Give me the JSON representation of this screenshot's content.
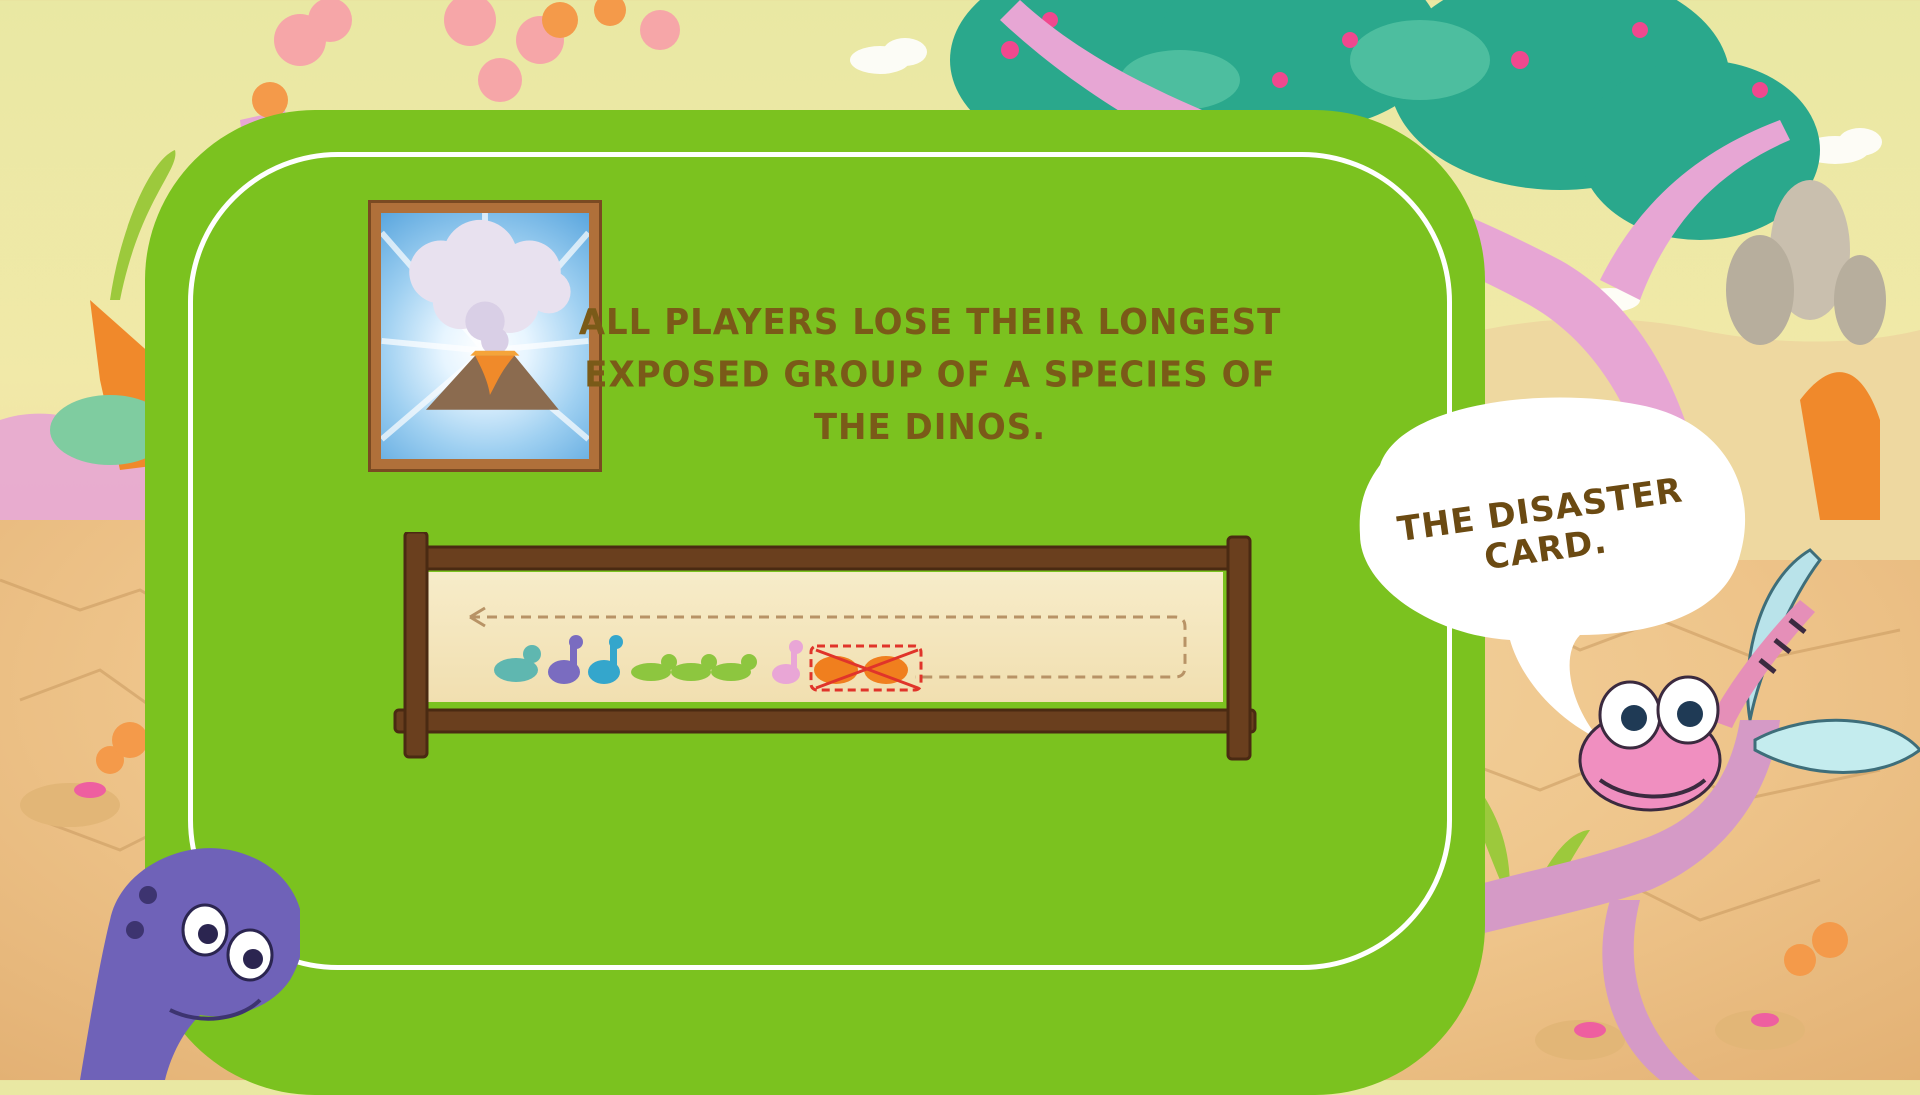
{
  "rule_text": "ALL PLAYERS LOSE THEIR LONGEST EXPOSED GROUP OF A SPECIES OF THE DINOS.",
  "bubble_text": "THE DISASTER CARD.",
  "card": {
    "name": "volcano-disaster-card"
  },
  "dino_row": {
    "sequence": [
      "teal",
      "purple",
      "blue",
      "green",
      "green",
      "green",
      "pink",
      "orange",
      "orange"
    ],
    "crossed_out": [
      "orange",
      "orange"
    ]
  },
  "colors": {
    "panel": "#7bc21f",
    "panel_border": "#ffffff",
    "text": "#7a5a18",
    "wood": "#6a3f1e",
    "paper": "#f4e6bd",
    "cross": "#e0342a"
  }
}
